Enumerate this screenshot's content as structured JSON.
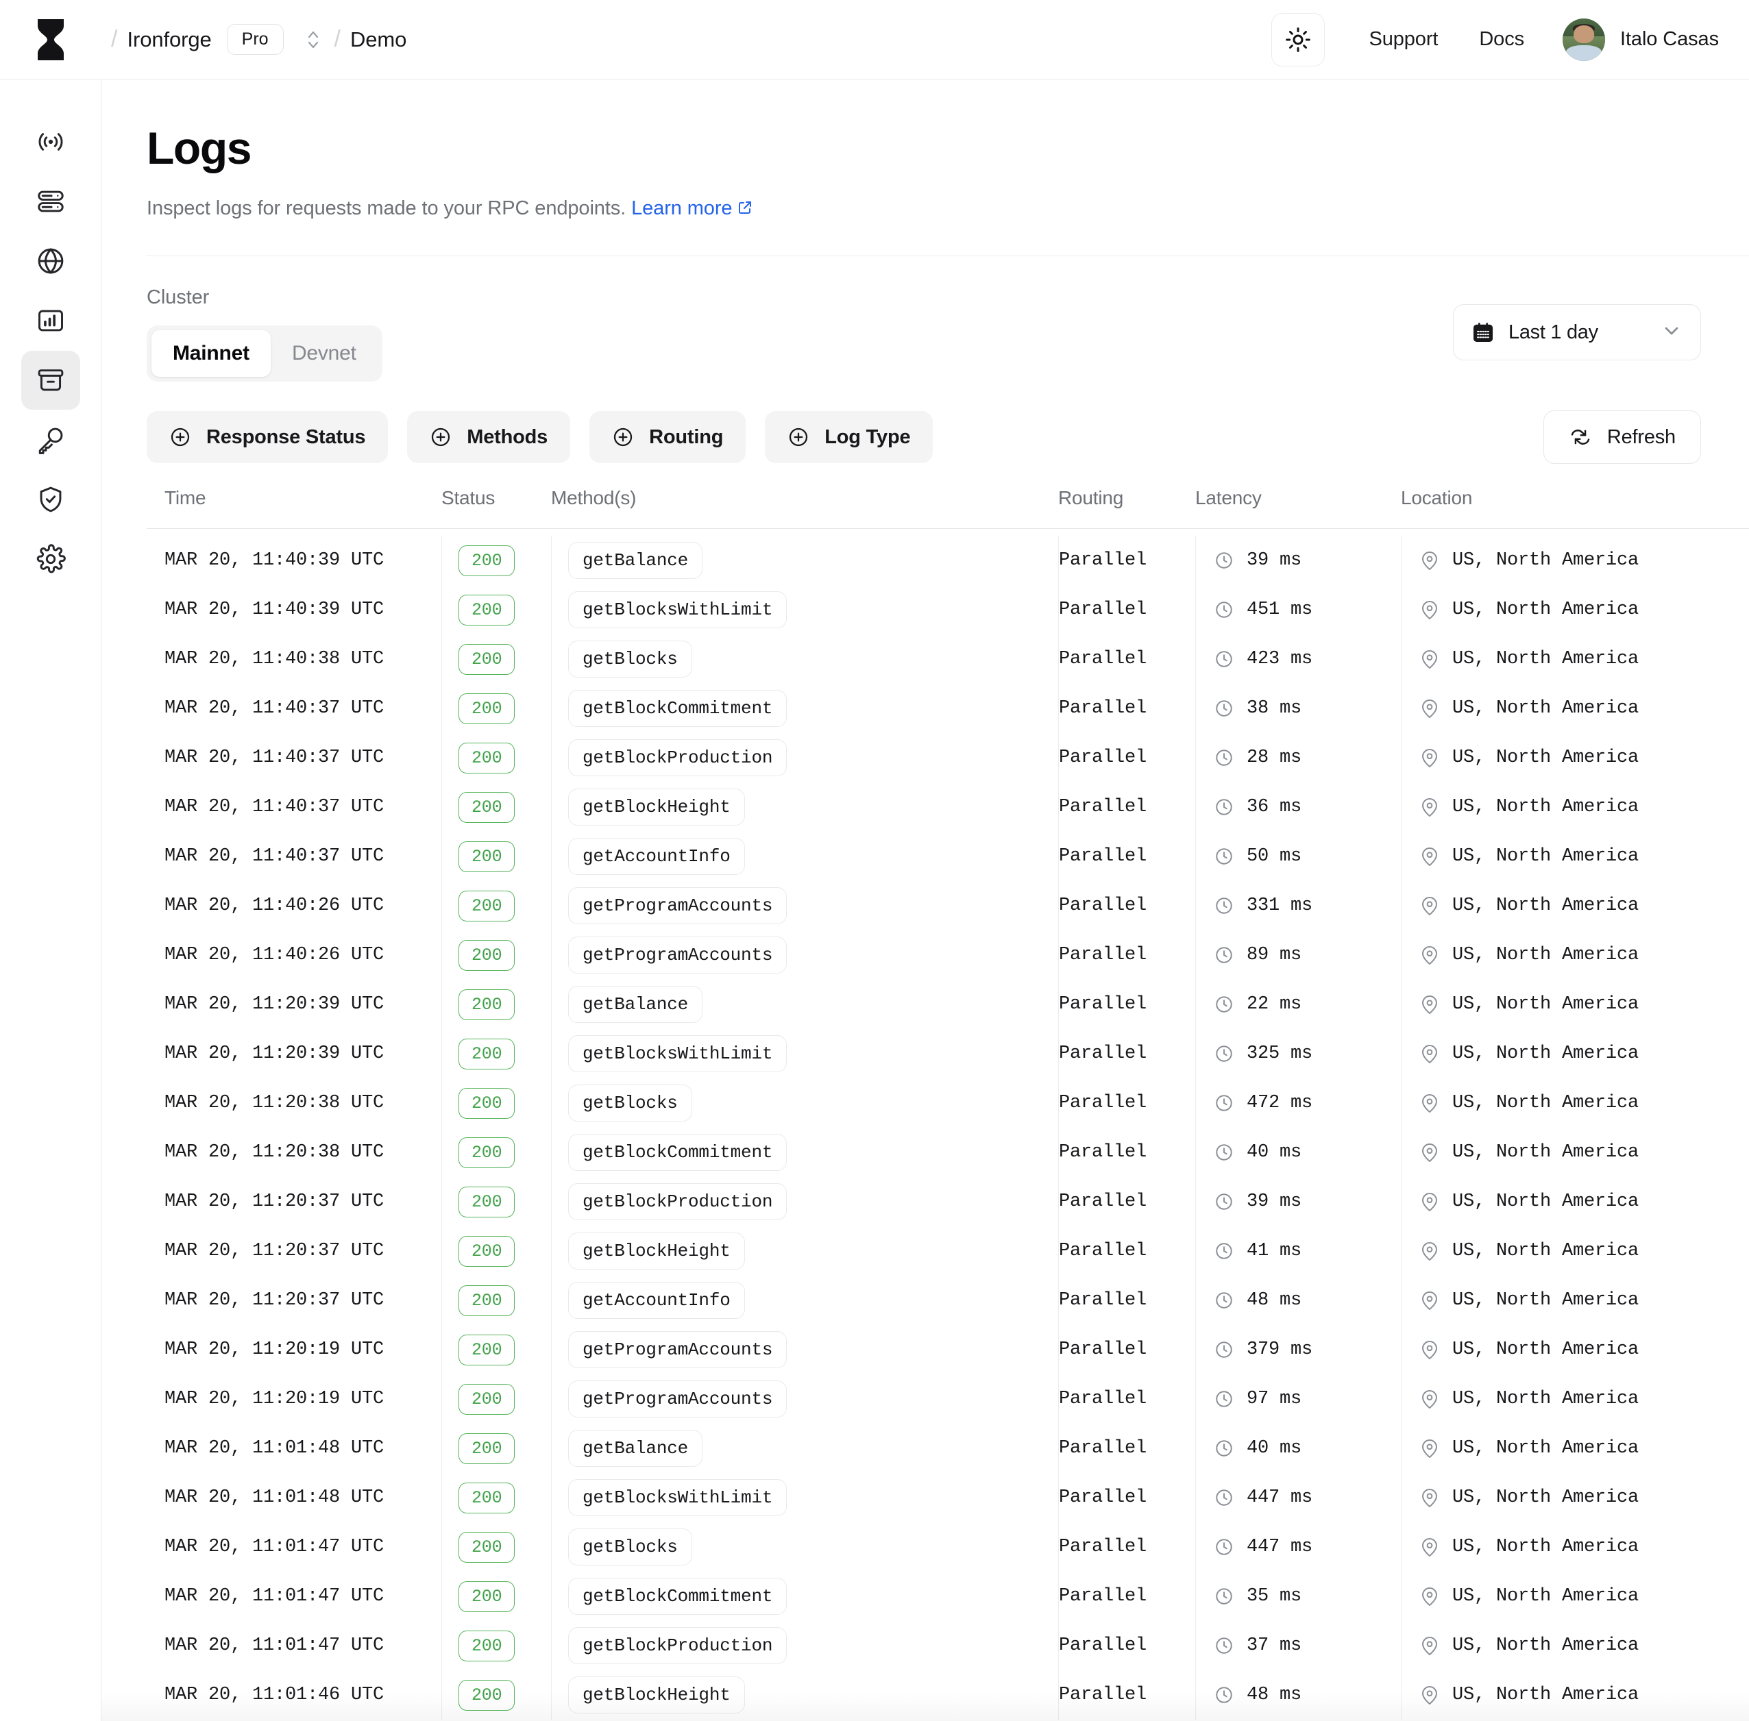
{
  "header": {
    "logo_icon": "ironforge-logo-icon",
    "breadcrumb_sep": "/",
    "org_name": "Ironforge",
    "plan_badge": "Pro",
    "project_name": "Demo",
    "theme_toggle_icon": "sun-icon",
    "support_label": "Support",
    "docs_label": "Docs",
    "user_name": "Italo Casas"
  },
  "sidebar": {
    "items": [
      {
        "icon": "broadcast-icon",
        "active": false
      },
      {
        "icon": "database-icon",
        "active": false
      },
      {
        "icon": "globe-icon",
        "active": false
      },
      {
        "icon": "chart-bar-icon",
        "active": false
      },
      {
        "icon": "archive-icon",
        "active": true
      },
      {
        "icon": "key-icon",
        "active": false
      },
      {
        "icon": "shield-check-icon",
        "active": false
      },
      {
        "icon": "gear-icon",
        "active": false
      }
    ]
  },
  "page": {
    "title": "Logs",
    "subtitle": "Inspect logs for requests made to your RPC endpoints.",
    "learn_more": "Learn more"
  },
  "filters": {
    "cluster_label": "Cluster",
    "cluster_options": [
      "Mainnet",
      "Devnet"
    ],
    "cluster_selected": "Mainnet",
    "date_range": "Last 1 day",
    "date_icon": "calendar-icon",
    "chevron_icon": "chevron-down-icon",
    "chips": [
      {
        "label": "Response Status",
        "icon": "plus-circle-icon"
      },
      {
        "label": "Methods",
        "icon": "plus-circle-icon"
      },
      {
        "label": "Routing",
        "icon": "plus-circle-icon"
      },
      {
        "label": "Log Type",
        "icon": "plus-circle-icon"
      }
    ],
    "refresh_label": "Refresh",
    "refresh_icon": "refresh-icon"
  },
  "table": {
    "columns": [
      "Time",
      "Status",
      "Method(s)",
      "Routing",
      "Latency",
      "Location"
    ],
    "latency_icon": "clock-icon",
    "location_icon": "map-pin-icon",
    "rows": [
      {
        "time": "MAR 20, 11:40:39 UTC",
        "status": "200",
        "method": "getBalance",
        "routing": "Parallel",
        "latency": "39 ms",
        "location": "US, North America"
      },
      {
        "time": "MAR 20, 11:40:39 UTC",
        "status": "200",
        "method": "getBlocksWithLimit",
        "routing": "Parallel",
        "latency": "451 ms",
        "location": "US, North America"
      },
      {
        "time": "MAR 20, 11:40:38 UTC",
        "status": "200",
        "method": "getBlocks",
        "routing": "Parallel",
        "latency": "423 ms",
        "location": "US, North America"
      },
      {
        "time": "MAR 20, 11:40:37 UTC",
        "status": "200",
        "method": "getBlockCommitment",
        "routing": "Parallel",
        "latency": "38 ms",
        "location": "US, North America"
      },
      {
        "time": "MAR 20, 11:40:37 UTC",
        "status": "200",
        "method": "getBlockProduction",
        "routing": "Parallel",
        "latency": "28 ms",
        "location": "US, North America"
      },
      {
        "time": "MAR 20, 11:40:37 UTC",
        "status": "200",
        "method": "getBlockHeight",
        "routing": "Parallel",
        "latency": "36 ms",
        "location": "US, North America"
      },
      {
        "time": "MAR 20, 11:40:37 UTC",
        "status": "200",
        "method": "getAccountInfo",
        "routing": "Parallel",
        "latency": "50 ms",
        "location": "US, North America"
      },
      {
        "time": "MAR 20, 11:40:26 UTC",
        "status": "200",
        "method": "getProgramAccounts",
        "routing": "Parallel",
        "latency": "331 ms",
        "location": "US, North America"
      },
      {
        "time": "MAR 20, 11:40:26 UTC",
        "status": "200",
        "method": "getProgramAccounts",
        "routing": "Parallel",
        "latency": "89 ms",
        "location": "US, North America"
      },
      {
        "time": "MAR 20, 11:20:39 UTC",
        "status": "200",
        "method": "getBalance",
        "routing": "Parallel",
        "latency": "22 ms",
        "location": "US, North America"
      },
      {
        "time": "MAR 20, 11:20:39 UTC",
        "status": "200",
        "method": "getBlocksWithLimit",
        "routing": "Parallel",
        "latency": "325 ms",
        "location": "US, North America"
      },
      {
        "time": "MAR 20, 11:20:38 UTC",
        "status": "200",
        "method": "getBlocks",
        "routing": "Parallel",
        "latency": "472 ms",
        "location": "US, North America"
      },
      {
        "time": "MAR 20, 11:20:38 UTC",
        "status": "200",
        "method": "getBlockCommitment",
        "routing": "Parallel",
        "latency": "40 ms",
        "location": "US, North America"
      },
      {
        "time": "MAR 20, 11:20:37 UTC",
        "status": "200",
        "method": "getBlockProduction",
        "routing": "Parallel",
        "latency": "39 ms",
        "location": "US, North America"
      },
      {
        "time": "MAR 20, 11:20:37 UTC",
        "status": "200",
        "method": "getBlockHeight",
        "routing": "Parallel",
        "latency": "41 ms",
        "location": "US, North America"
      },
      {
        "time": "MAR 20, 11:20:37 UTC",
        "status": "200",
        "method": "getAccountInfo",
        "routing": "Parallel",
        "latency": "48 ms",
        "location": "US, North America"
      },
      {
        "time": "MAR 20, 11:20:19 UTC",
        "status": "200",
        "method": "getProgramAccounts",
        "routing": "Parallel",
        "latency": "379 ms",
        "location": "US, North America"
      },
      {
        "time": "MAR 20, 11:20:19 UTC",
        "status": "200",
        "method": "getProgramAccounts",
        "routing": "Parallel",
        "latency": "97 ms",
        "location": "US, North America"
      },
      {
        "time": "MAR 20, 11:01:48 UTC",
        "status": "200",
        "method": "getBalance",
        "routing": "Parallel",
        "latency": "40 ms",
        "location": "US, North America"
      },
      {
        "time": "MAR 20, 11:01:48 UTC",
        "status": "200",
        "method": "getBlocksWithLimit",
        "routing": "Parallel",
        "latency": "447 ms",
        "location": "US, North America"
      },
      {
        "time": "MAR 20, 11:01:47 UTC",
        "status": "200",
        "method": "getBlocks",
        "routing": "Parallel",
        "latency": "447 ms",
        "location": "US, North America"
      },
      {
        "time": "MAR 20, 11:01:47 UTC",
        "status": "200",
        "method": "getBlockCommitment",
        "routing": "Parallel",
        "latency": "35 ms",
        "location": "US, North America"
      },
      {
        "time": "MAR 20, 11:01:47 UTC",
        "status": "200",
        "method": "getBlockProduction",
        "routing": "Parallel",
        "latency": "37 ms",
        "location": "US, North America"
      },
      {
        "time": "MAR 20, 11:01:46 UTC",
        "status": "200",
        "method": "getBlockHeight",
        "routing": "Parallel",
        "latency": "48 ms",
        "location": "US, North America"
      }
    ]
  },
  "colors": {
    "accent_link": "#2563eb",
    "status_success": "#42a34b",
    "active_nav_bg": "#ededee"
  }
}
